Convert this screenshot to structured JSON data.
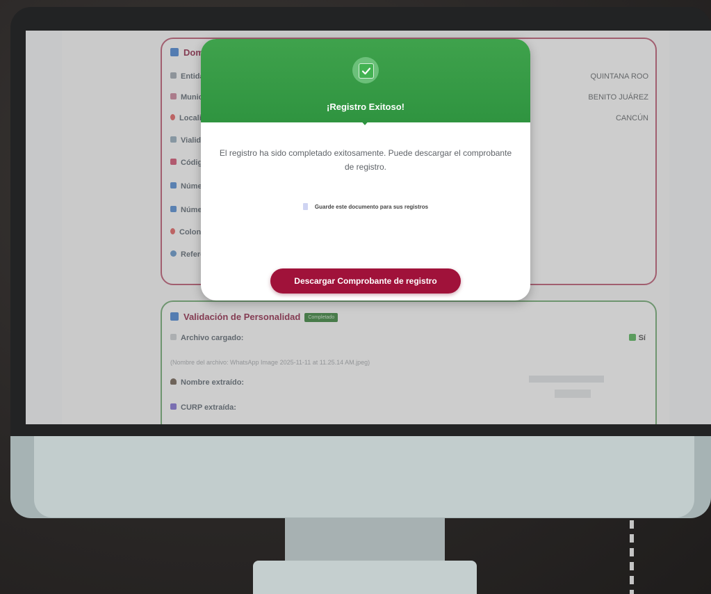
{
  "domicilio": {
    "title": "Domicilio F",
    "fields": [
      {
        "label": "Entidad:",
        "value": "QUINTANA ROO"
      },
      {
        "label": "Municipio:",
        "value": "BENITO JUÁREZ"
      },
      {
        "label": "Localidad:",
        "value": "CANCÚN"
      },
      {
        "label": "Vialidad:"
      },
      {
        "label": "Código post"
      },
      {
        "label": "Número Ext"
      },
      {
        "label": "Número Inte"
      },
      {
        "label": "Colonia:"
      },
      {
        "label": "Referencias:"
      }
    ]
  },
  "validacion": {
    "title": "Validación de Personalidad",
    "badge": "Completado",
    "archivo_label": "Archivo cargado:",
    "archivo_value": "Sí",
    "filename": "(Nombre del archivo: WhatsApp Image 2025-11-11 at 11.25.14 AM.jpeg)",
    "nombre_label": "Nombre extraído:",
    "curp_label": "CURP extraída:"
  },
  "modal": {
    "title": "¡Registro Exitoso!",
    "message": "El registro ha sido completado exitosamente. Puede descargar el comprobante de registro.",
    "note": "Guarde este documento para sus registros",
    "button": "Descargar Comprobante de registro"
  },
  "colors": {
    "success": "#2f9440",
    "primary": "#a0123a",
    "card_red_border": "#b7506b",
    "card_green_border": "#69a56b"
  }
}
